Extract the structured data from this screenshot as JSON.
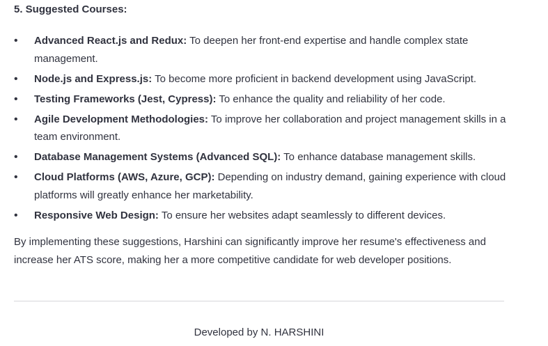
{
  "heading": "5. Suggested Courses:",
  "courses": [
    {
      "name": "Advanced React.js and Redux:",
      "desc": " To deepen her front-end expertise and handle complex state management."
    },
    {
      "name": "Node.js and Express.js:",
      "desc": " To become more proficient in backend development using JavaScript."
    },
    {
      "name": "Testing Frameworks (Jest, Cypress):",
      "desc": " To enhance the quality and reliability of her code."
    },
    {
      "name": "Agile Development Methodologies:",
      "desc": " To improve her collaboration and project management skills in a team environment."
    },
    {
      "name": "Database Management Systems (Advanced SQL):",
      "desc": " To enhance database management skills."
    },
    {
      "name": "Cloud Platforms (AWS, Azure, GCP):",
      "desc": " Depending on industry demand, gaining experience with cloud platforms will greatly enhance her marketability."
    },
    {
      "name": "Responsive Web Design:",
      "desc": " To ensure her websites adapt seamlessly to different devices."
    }
  ],
  "summary": "By implementing these suggestions, Harshini can significantly improve her resume's effectiveness and increase her ATS score, making her a more competitive candidate for web developer positions.",
  "footer": "Developed by N. HARSHINI",
  "bullet_glyph": "•"
}
